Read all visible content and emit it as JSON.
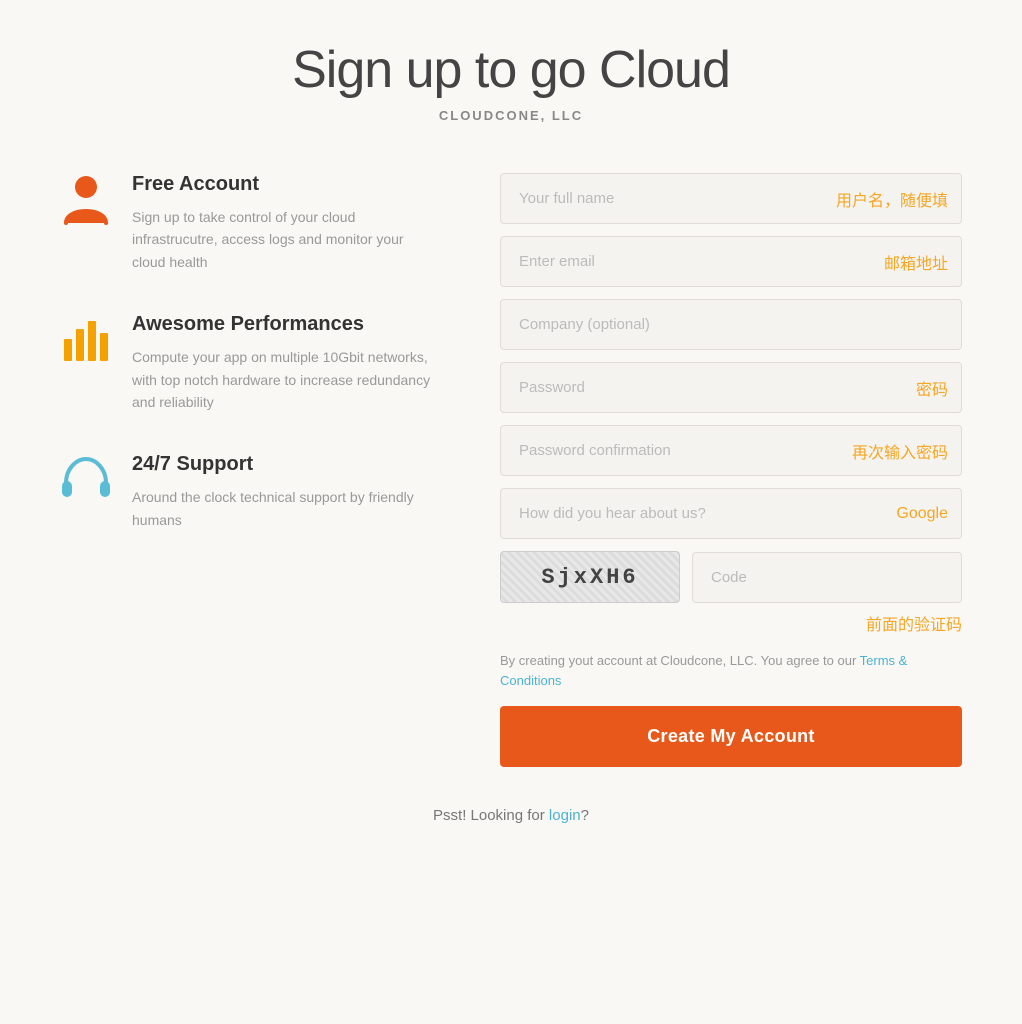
{
  "header": {
    "title": "Sign up to go Cloud",
    "company": "CLOUDCONE, LLC"
  },
  "features": [
    {
      "id": "free-account",
      "title": "Free Account",
      "description": "Sign up to take control of your cloud infrastrucutre, access logs and monitor your cloud health",
      "icon": "person"
    },
    {
      "id": "awesome-performances",
      "title": "Awesome Performances",
      "description": "Compute your app on multiple 10Gbit networks, with top notch hardware to increase redundancy and reliability",
      "icon": "bars"
    },
    {
      "id": "support",
      "title": "24/7 Support",
      "description": "Around the clock technical support by friendly humans",
      "icon": "headphones"
    }
  ],
  "form": {
    "fullname_placeholder": "Your full name",
    "fullname_annotation": "用户名，随便填",
    "email_placeholder": "Enter email",
    "email_annotation": "邮箱地址",
    "company_placeholder": "Company (optional)",
    "password_placeholder": "Password",
    "password_annotation": "密码",
    "password_confirm_placeholder": "Password confirmation",
    "password_confirm_annotation": "再次输入密码",
    "referral_placeholder": "How did you hear about us?",
    "referral_annotation": "Google",
    "captcha_text": "SjxXH6",
    "captcha_input_placeholder": "Code",
    "captcha_annotation": "前面的验证码",
    "terms_text": "By creating yout account at Cloudcone, LLC. You agree to our ",
    "terms_link_text": "Terms & Conditions",
    "submit_label": "Create My Account"
  },
  "footer": {
    "text": "Psst! Looking for ",
    "login_label": "login",
    "suffix": "?"
  },
  "colors": {
    "orange": "#e8581a",
    "gold": "#f5a100",
    "teal": "#5bbcd6",
    "link": "#4ab3d3"
  }
}
